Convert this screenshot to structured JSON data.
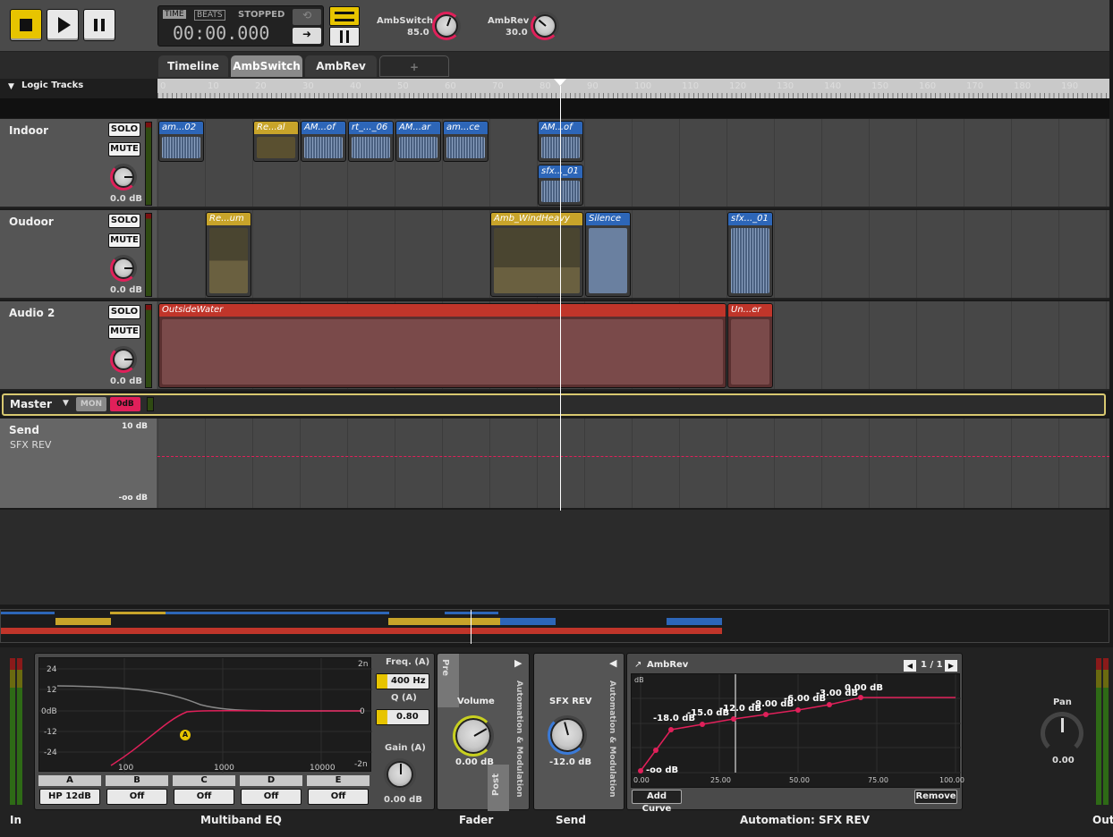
{
  "transport": {
    "mode_time": "TIME",
    "mode_beats": "BEATS",
    "status": "STOPPED",
    "timecode": "00:00.000"
  },
  "params": [
    {
      "name": "AmbSwitch",
      "value": "85.0"
    },
    {
      "name": "AmbRev",
      "value": "30.0"
    }
  ],
  "tabs": [
    "Timeline",
    "AmbSwitch",
    "AmbRev",
    "+"
  ],
  "logic_tracks_label": "Logic Tracks",
  "ruler": [
    "0",
    "10",
    "20",
    "30",
    "40",
    "50",
    "60",
    "70",
    "80",
    "90",
    "100",
    "110",
    "120",
    "130",
    "140",
    "150",
    "160",
    "170",
    "180",
    "190"
  ],
  "tracks": [
    {
      "name": "Indoor",
      "solo": "SOLO",
      "mute": "MUTE",
      "db": "0.0 dB",
      "clips": [
        "am...02",
        "Re...al",
        "AM...of",
        "rt_..._06",
        "AM...ar",
        "am...ce",
        "AM...of",
        "sfx..._01"
      ]
    },
    {
      "name": "Oudoor",
      "solo": "SOLO",
      "mute": "MUTE",
      "db": "0.0 dB",
      "clips": [
        "Re...um",
        "Amb_WindHeavy",
        "Silence",
        "sfx..._01"
      ]
    },
    {
      "name": "Audio 2",
      "solo": "SOLO",
      "mute": "MUTE",
      "db": "0.0 dB",
      "clips": [
        "OutsideWater",
        "Un...er"
      ]
    }
  ],
  "master": {
    "name": "Master",
    "mon": "MON",
    "level": "0dB"
  },
  "send": {
    "name": "Send",
    "target": "SFX REV",
    "top": "10 dB",
    "bottom": "-oo dB"
  },
  "eq": {
    "y_labels": [
      "24",
      "12",
      "0dB",
      "-12",
      "-24"
    ],
    "right_labels": [
      "2n",
      "0",
      "-2n"
    ],
    "x_labels": [
      "100",
      "1000",
      "10000"
    ],
    "freq_label": "Freq. (A)",
    "freq": "400 Hz",
    "q_label": "Q (A)",
    "q": "0.80",
    "gain_label": "Gain (A)",
    "gain": "0.00 dB",
    "bands": [
      {
        "name": "A",
        "value": "HP 12dB"
      },
      {
        "name": "B",
        "value": "Off"
      },
      {
        "name": "C",
        "value": "Off"
      },
      {
        "name": "D",
        "value": "Off"
      },
      {
        "name": "E",
        "value": "Off"
      }
    ],
    "marker": "A"
  },
  "fader": {
    "pre": "Pre",
    "post": "Post",
    "label": "Volume",
    "value": "0.00 dB",
    "side": "Automation & Modulation"
  },
  "send_panel": {
    "label": "SFX REV",
    "value": "-12.0 dB",
    "side": "Automation & Modulation"
  },
  "automation": {
    "title": "AmbRev",
    "page": "1 / 1",
    "unit": "dB",
    "x_labels": [
      "0.00",
      "25.00",
      "50.00",
      "75.00",
      "100.00"
    ],
    "point_labels": [
      "-oo dB",
      "-18.0 dB",
      "-15.0 dB",
      "-12.0 dB",
      "-9.00 dB",
      "-6.00 dB",
      "-3.00 dB",
      "0.00 dB"
    ],
    "add": "Add Curve",
    "remove": "Remove"
  },
  "pan": {
    "label": "Pan",
    "value": "0.00"
  },
  "footer": {
    "in": "In",
    "eq": "Multiband EQ",
    "fader": "Fader",
    "send": "Send",
    "automation": "Automation: SFX REV",
    "out": "Out"
  }
}
